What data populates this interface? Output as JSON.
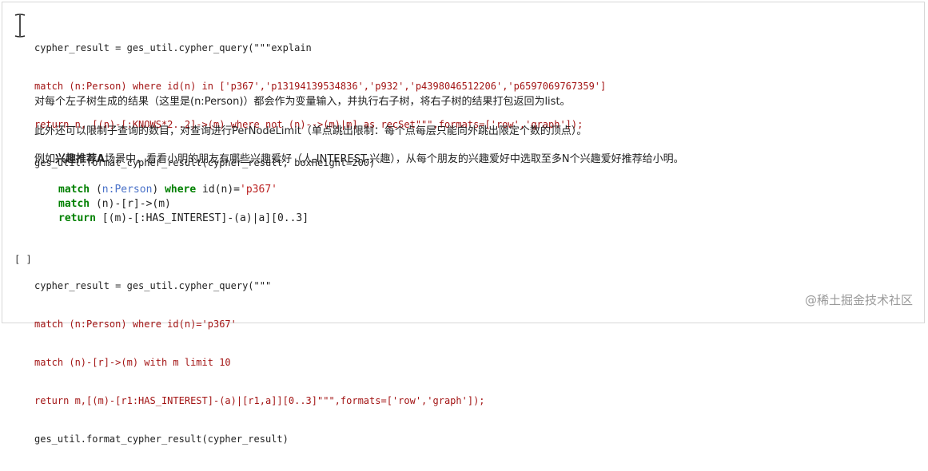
{
  "cell1": {
    "lines": [
      "cypher_result = ges_util.cypher_query(\"\"\"explain",
      "match (n:Person) where id(n) in ['p367','p13194139534836','p932','p4398046512206','p6597069767359']",
      "return n, [(n)-[:KNOWS*2..2]->(m) where not (n)-->(m)|m] as recSet\"\"\",formats=['row','graph']);",
      "ges_util.format_cypher_result(cypher_result, boxHeight=200)"
    ]
  },
  "markdown": {
    "p1": "对每个左子树生成的结果（这里是(n:Person)）都会作为变量输入，并执行右子树，将右子树的结果打包返回为list。",
    "p2": "此外还可以限制子查询的数目，对查询进行PerNodeLimit（单点跳出限制：每个点每层只能向外跳出限定个数的顶点）。",
    "p3_prefix": "例如",
    "p3_bold": "兴趣推荐A",
    "p3_suffix": "场景中，看看小明的朋友有哪些兴趣爱好（人-INTEREST-兴趣），从每个朋友的兴趣爱好中选取至多N个兴趣爱好推荐给小明。",
    "code": {
      "l1_kw1": "match",
      "l1_a": " (",
      "l1_label": "n:Person",
      "l1_b": ") ",
      "l1_kw2": "where",
      "l1_c": " id(n)=",
      "l1_str": "'p367'",
      "l2_kw": "match",
      "l2_rest": " (n)-[r]->(m)",
      "l3_kw": "return",
      "l3_rest": " [(m)-[:HAS_INTEREST]-(a)|a][0..3]"
    }
  },
  "cell2": {
    "run_indicator": "[ ]",
    "lines": [
      "cypher_result = ges_util.cypher_query(\"\"\"",
      "match (n:Person) where id(n)='p367'",
      "match (n)-[r]->(m) with m limit 10",
      "return m,[(m)-[r1:HAS_INTEREST]-(a)|[r1,a]][0..3]\"\"\",formats=['row','graph']);",
      "ges_util.format_cypher_result(cypher_result)"
    ]
  },
  "watermark": "@稀土掘金技术社区"
}
